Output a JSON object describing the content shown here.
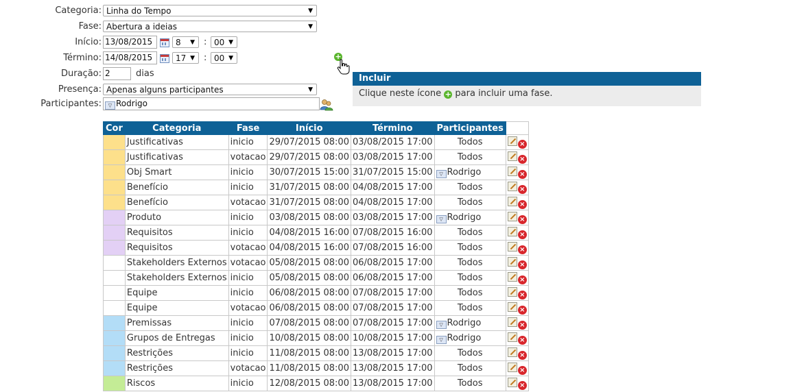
{
  "form": {
    "categoria_label": "Categoria:",
    "categoria_value": "Linha do Tempo",
    "fase_label": "Fase:",
    "fase_value": "Abertura a ideias",
    "inicio_label": "Início:",
    "inicio_date": "13/08/2015",
    "inicio_hour": "8",
    "inicio_min": "00",
    "termino_label": "Término:",
    "termino_date": "14/08/2015",
    "termino_hour": "17",
    "termino_min": "00",
    "colon": ":",
    "duracao_label": "Duração:",
    "duracao_value": "2",
    "duracao_unit": "dias",
    "presenca_label": "Presença:",
    "presenca_value": "Apenas alguns participantes",
    "participantes_label": "Participantes:",
    "participantes_value": "Rodrigo"
  },
  "tooltip": {
    "title": "Incluir",
    "text_before": "Clique neste ícone",
    "text_after": "para incluir uma fase."
  },
  "table": {
    "headers": [
      "Cor",
      "Categoria",
      "Fase",
      "Início",
      "Término",
      "Participantes"
    ],
    "rows": [
      {
        "color": "#fde08b",
        "categoria": "Justificativas",
        "fase": "inicio",
        "inicio": "29/07/2015 08:00",
        "termino": "03/08/2015 17:00",
        "participantes": "Todos",
        "dropdown": false
      },
      {
        "color": "#fde08b",
        "categoria": "Justificativas",
        "fase": "votacao",
        "inicio": "29/07/2015 08:00",
        "termino": "03/08/2015 17:00",
        "participantes": "Todos",
        "dropdown": false
      },
      {
        "color": "#fde08b",
        "categoria": "Obj Smart",
        "fase": "inicio",
        "inicio": "30/07/2015 15:00",
        "termino": "31/07/2015 15:00",
        "participantes": "Rodrigo",
        "dropdown": true
      },
      {
        "color": "#fde08b",
        "categoria": "Benefício",
        "fase": "inicio",
        "inicio": "31/07/2015 08:00",
        "termino": "04/08/2015 17:00",
        "participantes": "Todos",
        "dropdown": false
      },
      {
        "color": "#fde08b",
        "categoria": "Benefício",
        "fase": "votacao",
        "inicio": "31/07/2015 08:00",
        "termino": "04/08/2015 17:00",
        "participantes": "Todos",
        "dropdown": false
      },
      {
        "color": "#e3d0f5",
        "categoria": "Produto",
        "fase": "inicio",
        "inicio": "03/08/2015 08:00",
        "termino": "03/08/2015 17:00",
        "participantes": "Rodrigo",
        "dropdown": true
      },
      {
        "color": "#e3d0f5",
        "categoria": "Requisitos",
        "fase": "inicio",
        "inicio": "04/08/2015 16:00",
        "termino": "07/08/2015 16:00",
        "participantes": "Todos",
        "dropdown": false
      },
      {
        "color": "#e3d0f5",
        "categoria": "Requisitos",
        "fase": "votacao",
        "inicio": "04/08/2015 16:00",
        "termino": "07/08/2015 16:00",
        "participantes": "Todos",
        "dropdown": false
      },
      {
        "color": "#ffffff",
        "categoria": "Stakeholders Externos",
        "fase": "votacao",
        "inicio": "05/08/2015 08:00",
        "termino": "06/08/2015 17:00",
        "participantes": "Todos",
        "dropdown": false
      },
      {
        "color": "#ffffff",
        "categoria": "Stakeholders Externos",
        "fase": "inicio",
        "inicio": "05/08/2015 08:00",
        "termino": "06/08/2015 17:00",
        "participantes": "Todos",
        "dropdown": false
      },
      {
        "color": "#ffffff",
        "categoria": "Equipe",
        "fase": "inicio",
        "inicio": "06/08/2015 08:00",
        "termino": "07/08/2015 17:00",
        "participantes": "Todos",
        "dropdown": false
      },
      {
        "color": "#ffffff",
        "categoria": "Equipe",
        "fase": "votacao",
        "inicio": "06/08/2015 08:00",
        "termino": "07/08/2015 17:00",
        "participantes": "Todos",
        "dropdown": false
      },
      {
        "color": "#b3ddf7",
        "categoria": "Premissas",
        "fase": "inicio",
        "inicio": "07/08/2015 08:00",
        "termino": "07/08/2015 17:00",
        "participantes": "Rodrigo",
        "dropdown": true
      },
      {
        "color": "#b3ddf7",
        "categoria": "Grupos de Entregas",
        "fase": "inicio",
        "inicio": "10/08/2015 08:00",
        "termino": "10/08/2015 17:00",
        "participantes": "Rodrigo",
        "dropdown": true
      },
      {
        "color": "#b3ddf7",
        "categoria": "Restrições",
        "fase": "inicio",
        "inicio": "11/08/2015 08:00",
        "termino": "13/08/2015 17:00",
        "participantes": "Todos",
        "dropdown": false
      },
      {
        "color": "#b3ddf7",
        "categoria": "Restrições",
        "fase": "votacao",
        "inicio": "11/08/2015 08:00",
        "termino": "13/08/2015 17:00",
        "participantes": "Todos",
        "dropdown": false
      },
      {
        "color": "#c4ec96",
        "categoria": "Riscos",
        "fase": "inicio",
        "inicio": "12/08/2015 08:00",
        "termino": "13/08/2015 17:00",
        "participantes": "Todos",
        "dropdown": false
      }
    ]
  },
  "icons": {
    "add": "plus-circle-icon",
    "calendar": "calendar-icon",
    "users": "users-icon",
    "edit": "edit-icon",
    "delete": "delete-icon",
    "cursor": "hand-cursor-icon"
  },
  "colors": {
    "header": "#0e6196",
    "add_green": "#5ab52d",
    "delete_red": "#d8262c"
  }
}
